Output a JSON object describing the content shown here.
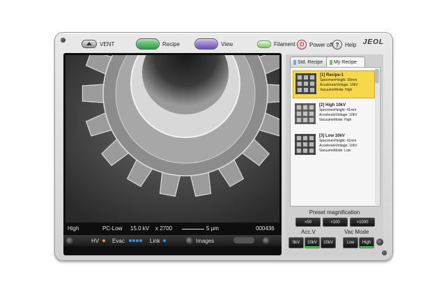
{
  "toolbar": {
    "vent_label": "VENT",
    "recipe_label": "Recipe",
    "view_label": "View",
    "filament_label": "Filament",
    "power_off_label": "Power off",
    "help_label": "Help",
    "logo": "JEOL"
  },
  "viewer": {
    "info": {
      "mode": "High",
      "pressure": "PC-Low",
      "voltage": "15.0 kV",
      "magnification": "x 2700",
      "scale": "5 μm",
      "image_number": "000436"
    },
    "status": {
      "hv_label": "HV",
      "evac_label": "Evac",
      "link_label": "Link",
      "images_label": "Images"
    }
  },
  "panel": {
    "tabs": [
      {
        "label": "Std. Recipe",
        "active": false
      },
      {
        "label": "My Recipe",
        "active": true
      }
    ],
    "recipes": [
      {
        "title": "[1] Recipe-1",
        "specimen": "SpecimenHeight: 50mm",
        "voltage": "AccelerateVoltage: 10kV",
        "vacuum": "VacuumeMode: High",
        "selected": true
      },
      {
        "title": "[2] High 10kV",
        "specimen": "SpecimenHeight: 41mm",
        "voltage": "AccelerateVoltage: 10kV",
        "vacuum": "VacuumeMode: High",
        "selected": false
      },
      {
        "title": "[3] Low 10kV",
        "specimen": "SpecimenHeight: 41mm",
        "voltage": "AccelerateVoltage: 10kV",
        "vacuum": "VacuumeMode: Low",
        "selected": false
      }
    ],
    "preset_title": "Preset magnification",
    "magnifications": [
      "×50",
      "×100",
      "×1000"
    ],
    "acc_label": "Acc.V",
    "acc_buttons": [
      "5kV",
      "10kV",
      "15kV"
    ],
    "vac_label": "Vac Mode",
    "vac_buttons": [
      "Low",
      "High"
    ]
  },
  "colors": {
    "selected_recipe": "#f7d84a",
    "status_dot_hv": "#e9a21a",
    "status_dot_evac": "#3b8fe8",
    "status_dot_link": "#3b8fe8"
  }
}
